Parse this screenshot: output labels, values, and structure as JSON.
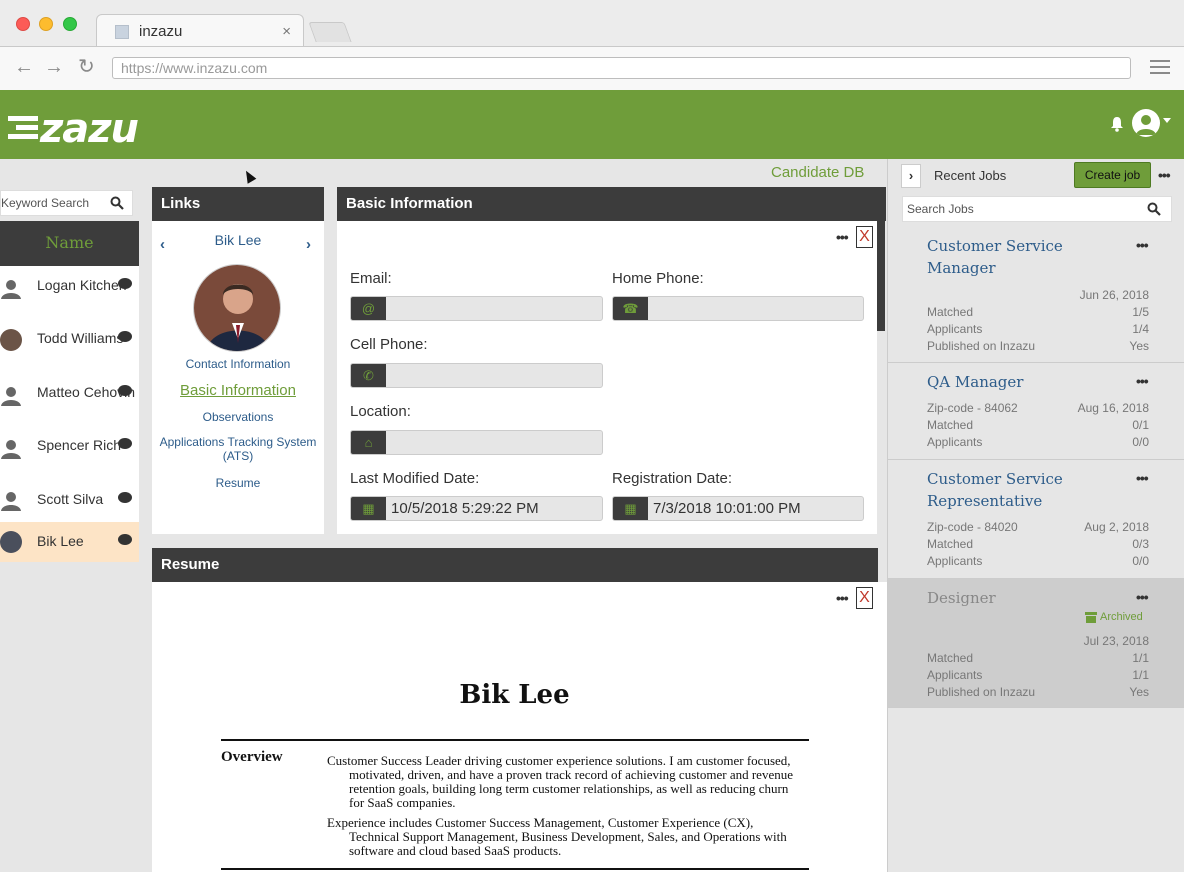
{
  "browser": {
    "tab_title": "inzazu",
    "tab_close": "×",
    "url": "https://www.inzazu.com",
    "back_icon": "←",
    "forward_icon": "→",
    "reload_icon": "↻"
  },
  "app": {
    "logo": "zazu",
    "accent": "#6f9d3a",
    "section_label": "Candidate DB"
  },
  "candidates": {
    "search_placeholder": "Keyword Search",
    "column_header": "Name",
    "items": [
      {
        "name": "Logan Kitchen"
      },
      {
        "name": "Todd Williams"
      },
      {
        "name": "Matteo Cehovin"
      },
      {
        "name": "Spencer Rich"
      },
      {
        "name": "Scott Silva"
      },
      {
        "name": "Bik Lee"
      }
    ]
  },
  "links": {
    "title": "Links",
    "current_name": "Bik Lee",
    "prev_icon": "‹",
    "next_icon": "›",
    "items": [
      "Contact Information",
      "Basic Information",
      "Observations",
      "Applications Tracking System (ATS)",
      "Resume"
    ]
  },
  "basic_info": {
    "title": "Basic Information",
    "close_label": "X",
    "more_label": "•••",
    "email_label": "Email:",
    "home_phone_label": "Home Phone:",
    "cell_phone_label": "Cell Phone:",
    "location_label": "Location:",
    "last_modified_label": "Last Modified Date:",
    "registration_label": "Registration Date:",
    "email_icon": "@",
    "home_phone_icon": "☎",
    "cell_phone_icon": "✆",
    "location_icon": "⌂",
    "calendar_icon": "▦",
    "last_modified_value": "10/5/2018 5:29:22 PM",
    "registration_value": "7/3/2018 10:01:00 PM"
  },
  "resume": {
    "title": "Resume",
    "close_label": "X",
    "more_label": "•••",
    "name": "Bik Lee",
    "section_heading": "Overview",
    "para1": "Customer Success Leader driving customer experience solutions. I am customer focused, motivated, driven, and have a proven track record of achieving customer and revenue retention goals, building long term customer relationships, as well as reducing churn for SaaS companies.",
    "para2": "Experience includes Customer Success Management, Customer Experience (CX), Technical Support Management, Business Development, Sales, and Operations with software and cloud based SaaS products."
  },
  "jobs": {
    "title": "Recent Jobs",
    "toggle": "›",
    "create_label": "Create job",
    "more_label": "•••",
    "search_placeholder": "Search Jobs",
    "cards": [
      {
        "title_l1": "Customer Service",
        "title_l2": "Manager",
        "date": "Jun 26, 2018",
        "matched_label": "Matched",
        "matched": "1/5",
        "applicants_label": "Applicants",
        "applicants": "1/4",
        "published_label": "Published on Inzazu",
        "published": "Yes"
      },
      {
        "title_l1": "QA Manager",
        "zip": "Zip-code - 84062",
        "date": "Aug 16, 2018",
        "matched_label": "Matched",
        "matched": "0/1",
        "applicants_label": "Applicants",
        "applicants": "0/0"
      },
      {
        "title_l1": "Customer Service",
        "title_l2": "Representative",
        "zip": "Zip-code - 84020",
        "date": "Aug 2, 2018",
        "matched_label": "Matched",
        "matched": "0/3",
        "applicants_label": "Applicants",
        "applicants": "0/0"
      },
      {
        "title_l1": "Designer",
        "status": "Archived",
        "date": "Jul 23, 2018",
        "matched_label": "Matched",
        "matched": "1/1",
        "applicants_label": "Applicants",
        "applicants": "1/1",
        "published_label": "Published on Inzazu",
        "published": "Yes"
      }
    ]
  }
}
